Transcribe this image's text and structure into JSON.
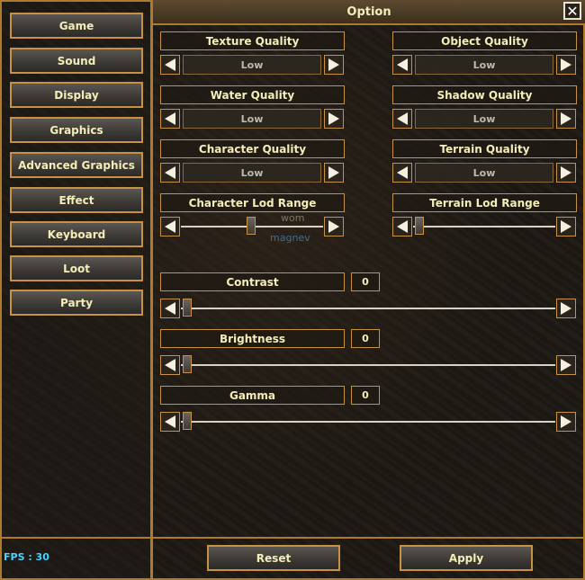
{
  "window": {
    "title": "Option",
    "close_icon": "close-icon"
  },
  "menu": {
    "items": [
      {
        "label": "Game"
      },
      {
        "label": "Sound"
      },
      {
        "label": "Display"
      },
      {
        "label": "Graphics"
      },
      {
        "label": "Advanced Graphics"
      },
      {
        "label": "Effect"
      },
      {
        "label": "Keyboard"
      },
      {
        "label": "Loot"
      },
      {
        "label": "Party"
      }
    ]
  },
  "graphics": {
    "texture_quality": {
      "label": "Texture Quality",
      "value": "Low"
    },
    "object_quality": {
      "label": "Object Quality",
      "value": "Low"
    },
    "water_quality": {
      "label": "Water Quality",
      "value": "Low"
    },
    "shadow_quality": {
      "label": "Shadow Quality",
      "value": "Low"
    },
    "character_quality": {
      "label": "Character Quality",
      "value": "Low"
    },
    "terrain_quality": {
      "label": "Terrain Quality",
      "value": "Low"
    },
    "character_lod_range": {
      "label": "Character Lod Range"
    },
    "terrain_lod_range": {
      "label": "Terrain Lod Range"
    },
    "contrast": {
      "label": "Contrast",
      "value": "0"
    },
    "brightness": {
      "label": "Brightness",
      "value": "0"
    },
    "gamma": {
      "label": "Gamma",
      "value": "0"
    }
  },
  "background_text": {
    "line1": "wom",
    "line2": "magnev"
  },
  "status": {
    "fps": "FPS : 30"
  },
  "footer": {
    "reset_label": "Reset",
    "apply_label": "Apply"
  },
  "colors": {
    "accent_border": "#c79243",
    "text": "#f4edb8",
    "fps": "#46d3ff"
  }
}
